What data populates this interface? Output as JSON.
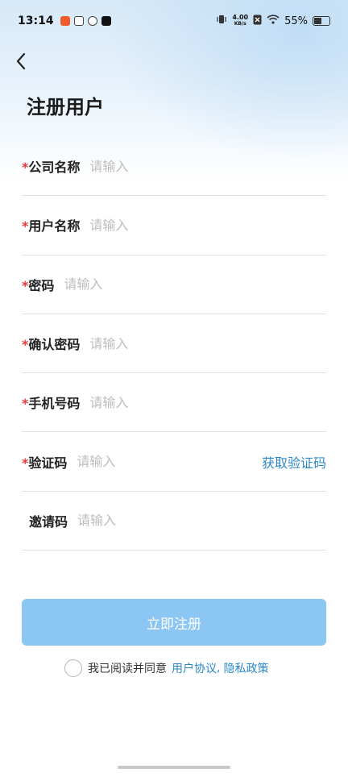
{
  "status_bar": {
    "time": "13:14",
    "net_speed_value": "4.00",
    "net_speed_unit": "KB/s",
    "battery": "55%"
  },
  "page": {
    "title": "注册用户"
  },
  "form": {
    "fields": [
      {
        "required_mark": "*",
        "label": "公司名称",
        "placeholder": "请输入"
      },
      {
        "required_mark": "*",
        "label": "用户名称",
        "placeholder": "请输入"
      },
      {
        "required_mark": "*",
        "label": "密码",
        "placeholder": "请输入"
      },
      {
        "required_mark": "*",
        "label": "确认密码",
        "placeholder": "请输入"
      },
      {
        "required_mark": "*",
        "label": "手机号码",
        "placeholder": "请输入"
      },
      {
        "required_mark": "*",
        "label": "验证码",
        "placeholder": "请输入",
        "action": "获取验证码"
      },
      {
        "label": "邀请码",
        "placeholder": "请输入"
      }
    ]
  },
  "submit": {
    "label": "立即注册"
  },
  "agreement": {
    "text": "我已阅读并同意",
    "user_agreement": "用户协议",
    "separator": ",",
    "privacy_policy": "隐私政策"
  },
  "colors": {
    "accent": "#2b88c8",
    "button": "#8cc6f2",
    "required": "#e23b3b"
  }
}
